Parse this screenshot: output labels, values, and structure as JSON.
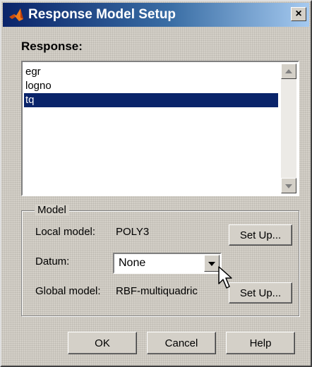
{
  "window": {
    "title": "Response Model Setup",
    "close_glyph": "×"
  },
  "response": {
    "label": "Response:",
    "items": [
      "egr",
      "logno",
      "tq"
    ],
    "selected_index": 2
  },
  "model": {
    "group_label": "Model",
    "local_label": "Local model:",
    "local_value": "POLY3",
    "local_setup": "Set Up...",
    "datum_label": "Datum:",
    "datum_value": "None",
    "global_label": "Global model:",
    "global_value": "RBF-multiquadric",
    "global_setup": "Set Up..."
  },
  "buttons": {
    "ok": "OK",
    "cancel": "Cancel",
    "help": "Help"
  },
  "colors": {
    "selection": "#0a246a",
    "titlebar_start": "#0a246a",
    "titlebar_end": "#a6caf0",
    "face": "#d4d0c8"
  }
}
